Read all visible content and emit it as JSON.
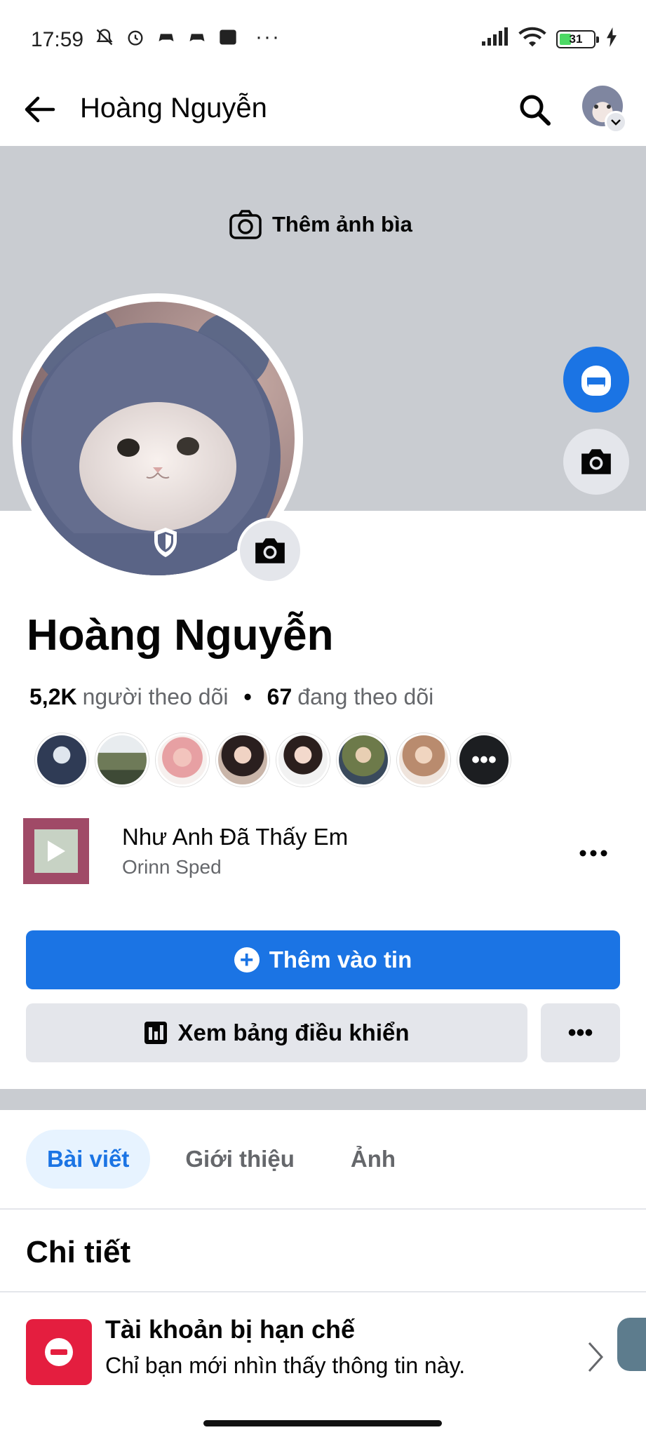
{
  "status_bar": {
    "time": "17:59",
    "battery": "31",
    "icons_left": [
      "mute-icon",
      "alarm-icon",
      "game-icon",
      "game-icon",
      "app-icon"
    ],
    "icons_right": [
      "signal-icon",
      "wifi-icon",
      "battery-icon",
      "charging-icon"
    ]
  },
  "header": {
    "title": "Hoàng Nguyễn"
  },
  "cover": {
    "add_cover_label": "Thêm ảnh bìa"
  },
  "profile": {
    "name": "Hoàng Nguyễn",
    "followers_count": "5,2K",
    "followers_label": "người theo dõi",
    "following_count": "67",
    "following_label": "đang theo dõi"
  },
  "followers": {
    "more_label": "•••"
  },
  "music": {
    "title": "Như Anh Đã Thấy Em",
    "artist": "Orinn Sped"
  },
  "actions": {
    "add_story": "Thêm vào tin",
    "dashboard": "Xem bảng điều khiển",
    "more": "•••"
  },
  "tabs": [
    {
      "label": "Bài viết",
      "active": true
    },
    {
      "label": "Giới thiệu",
      "active": false
    },
    {
      "label": "Ảnh",
      "active": false
    }
  ],
  "details": {
    "title": "Chi tiết",
    "restricted_title": "Tài khoản bị hạn chế",
    "restricted_sub": "Chỉ bạn mới nhìn thấy thông tin này."
  },
  "colors": {
    "accent": "#1b74e4",
    "danger": "#e41e3f",
    "cover": "#c9ccd1",
    "button_gray": "#e4e6eb"
  }
}
